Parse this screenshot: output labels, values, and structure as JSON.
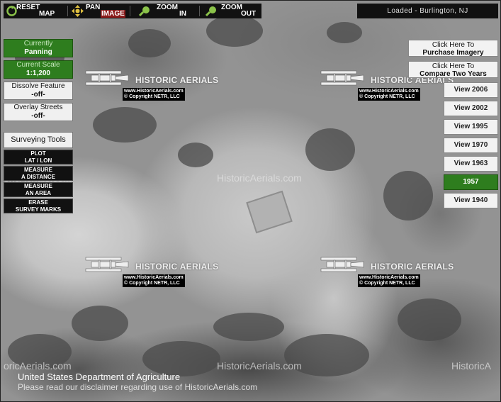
{
  "toolbar": {
    "reset": {
      "w1": "RESET",
      "w2": "MAP"
    },
    "pan": {
      "w1": "PAN",
      "w2": "IMAGE"
    },
    "zoom_in": {
      "w1": "ZOOM",
      "w2": "IN"
    },
    "zoom_out": {
      "w1": "ZOOM",
      "w2": "OUT"
    }
  },
  "status": {
    "loaded": "Loaded - Burlington, NJ"
  },
  "left": {
    "mode": {
      "label": "Currently",
      "value": "Panning"
    },
    "scale": {
      "label": "Current Scale",
      "value": "1:1,200"
    },
    "dissolve": {
      "label": "Dissolve Feature",
      "value": "-off-"
    },
    "overlay": {
      "label": "Overlay Streets",
      "value": "-off-"
    },
    "surveying": "Surveying Tools",
    "tools": [
      {
        "l1": "PLOT",
        "l2": "LAT / LON"
      },
      {
        "l1": "MEASURE",
        "l2": "A DISTANCE"
      },
      {
        "l1": "MEASURE",
        "l2": "AN AREA"
      },
      {
        "l1": "ERASE",
        "l2": "SURVEY MARKS"
      }
    ]
  },
  "right": {
    "purchase": {
      "l1": "Click Here To",
      "l2": "Purchase Imagery"
    },
    "compare": {
      "l1": "Click Here To",
      "l2": "Compare Two Years"
    },
    "years": [
      "View 2006",
      "View 2002",
      "View 1995",
      "View 1970",
      "View 1963",
      "1957",
      "View 1940"
    ],
    "active_year": "1957"
  },
  "watermark": {
    "brand": "HISTORIC AERIALS",
    "copy1": "www.HistoricAerials.com",
    "copy2": "© Copyright NETR, LLC",
    "site": "HistoricAerials.com",
    "partial_left": "oricAerials.com",
    "partial_right": "HistoricA"
  },
  "footer": {
    "agency": "United States Department of Agriculture",
    "disclaimer": "Please read our disclaimer regarding use of HistoricAerials.com"
  },
  "colors": {
    "active_green": "#2e7d1e",
    "toolbar_bg": "#111111"
  }
}
